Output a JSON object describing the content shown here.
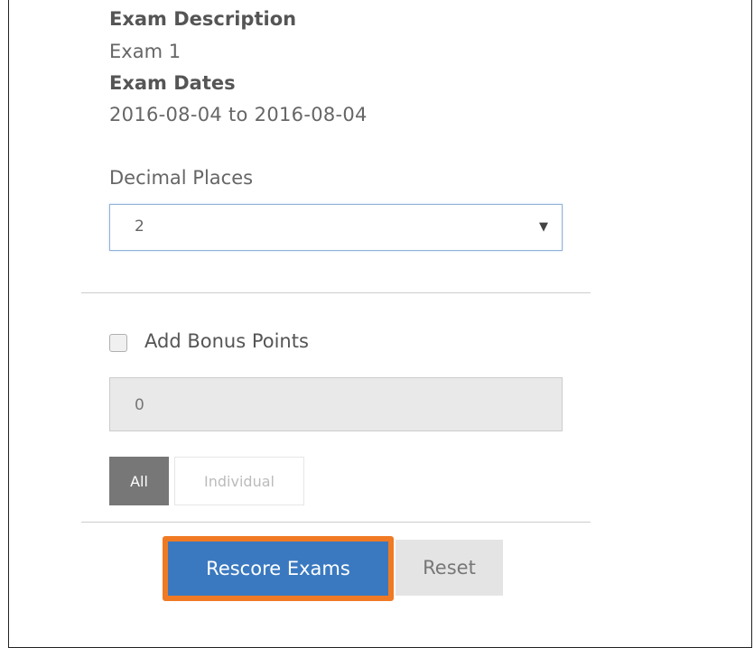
{
  "exam": {
    "description_label": "Exam Description",
    "description_value": "Exam 1",
    "dates_label": "Exam Dates",
    "dates_value": "2016-08-04 to 2016-08-04"
  },
  "decimal": {
    "label": "Decimal Places",
    "selected": "2"
  },
  "bonus": {
    "checkbox_label": "Add Bonus Points",
    "checked": false,
    "input_value": "0",
    "all_label": "All",
    "individual_label": "Individual"
  },
  "actions": {
    "rescore_label": "Rescore Exams",
    "reset_label": "Reset"
  },
  "colors": {
    "primary_button": "#3a79c0",
    "highlight_border": "#f07a24",
    "active_toggle": "#777777"
  }
}
